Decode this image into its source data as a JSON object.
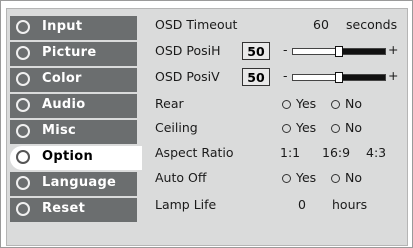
{
  "sidebar": {
    "items": [
      {
        "label": "Input"
      },
      {
        "label": "Picture"
      },
      {
        "label": "Color"
      },
      {
        "label": "Audio"
      },
      {
        "label": "Misc"
      },
      {
        "label": "Option"
      },
      {
        "label": "Language"
      },
      {
        "label": "Reset"
      }
    ]
  },
  "settings": {
    "osd_timeout": {
      "label": "OSD Timeout",
      "value": "60",
      "unit": "seconds"
    },
    "osd_posih": {
      "label": "OSD PosiH",
      "value": "50",
      "minus": "-",
      "plus": "+",
      "level": 0.5
    },
    "osd_posiv": {
      "label": "OSD PosiV",
      "value": "50",
      "minus": "-",
      "plus": "+",
      "level": 0.5
    },
    "rear": {
      "label": "Rear",
      "opt_yes": "Yes",
      "opt_no": "No"
    },
    "ceiling": {
      "label": "Ceiling",
      "opt_yes": "Yes",
      "opt_no": "No"
    },
    "aspect_ratio": {
      "label": "Aspect Ratio",
      "opt_1": "1:1",
      "opt_2": "16:9",
      "opt_3": "4:3"
    },
    "auto_off": {
      "label": "Auto Off",
      "opt_yes": "Yes",
      "opt_no": "No"
    },
    "lamp_life": {
      "label": "Lamp Life",
      "value": "0",
      "unit": "hours"
    }
  },
  "colors": {
    "sidebar_bg": "#6b6e6f",
    "panel_bg": "#dadbdb",
    "active_bg": "#ffffff"
  }
}
